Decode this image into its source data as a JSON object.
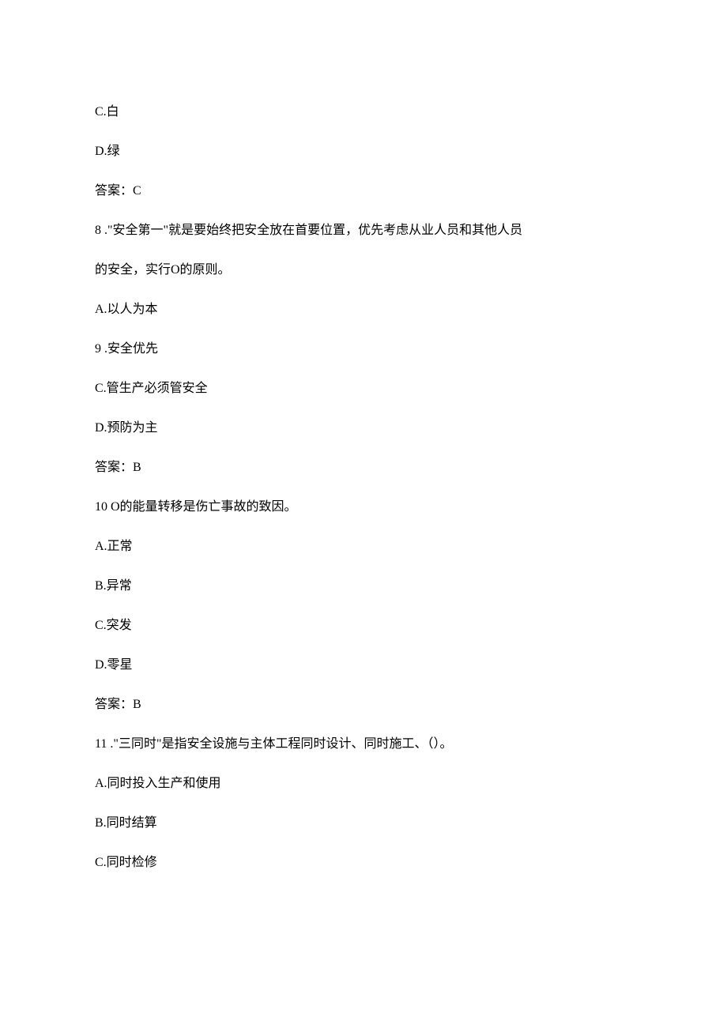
{
  "lines": {
    "l1": "C.白",
    "l2": "D.绿",
    "l3": "答案：C",
    "l4": "8 .\"安全第一\"就是要始终把安全放在首要位置，优先考虑从业人员和其他人员",
    "l5": "的安全，实行O的原则。",
    "l6": "A.以人为本",
    "l7": "9 .安全优先",
    "l8": "C.管生产必须管安全",
    "l9": "D.预防为主",
    "l10": "答案：B",
    "l11": "10 O的能量转移是伤亡事故的致因。",
    "l12": "A.正常",
    "l13": "B.异常",
    "l14": "C.突发",
    "l15": "D.零星",
    "l16": "答案：B",
    "l17": "11 .\"三同时\"是指安全设施与主体工程同时设计、同时施工、（）。",
    "l18": "A.同时投入生产和使用",
    "l19": "B.同时结算",
    "l20": "C.同时检修"
  }
}
